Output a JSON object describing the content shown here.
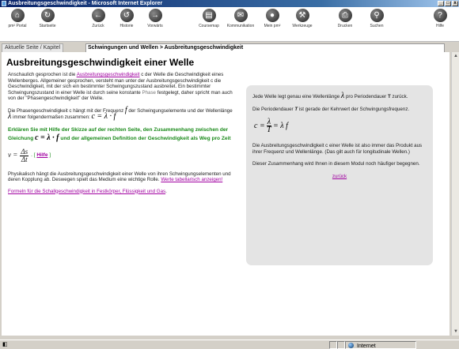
{
  "window": {
    "title": "Ausbreitungsgeschwindigkeit - Microsoft Internet Explorer",
    "btn_min": "_",
    "btn_max": "□",
    "btn_close": "x"
  },
  "toolbar": {
    "items": [
      {
        "label": "pm² Portal",
        "icon": "home-icon",
        "glyph": "⌂"
      },
      {
        "label": "Startseite",
        "icon": "start-icon",
        "glyph": "↻"
      },
      {
        "label": "Zurück",
        "icon": "back-icon",
        "glyph": "←"
      },
      {
        "label": "Historie",
        "icon": "history-icon",
        "glyph": "↺"
      },
      {
        "label": "Vorwärts",
        "icon": "forward-icon",
        "glyph": "→"
      },
      {
        "label": "Coursemap",
        "icon": "coursemap-icon",
        "glyph": "▤"
      },
      {
        "label": "Kommunikation",
        "icon": "communication-icon",
        "glyph": "✉"
      },
      {
        "label": "Mein pm²",
        "icon": "my-pm-icon",
        "glyph": "●"
      },
      {
        "label": "Werkzeuge",
        "icon": "tools-icon",
        "glyph": "⚒"
      },
      {
        "label": "Drucken",
        "icon": "print-icon",
        "glyph": "⎙"
      },
      {
        "label": "Suchen",
        "icon": "search-icon",
        "glyph": "⚲"
      },
      {
        "label": "Hilfe",
        "icon": "help-icon",
        "glyph": "?"
      }
    ]
  },
  "breadcrumb": {
    "label": "Aktuelle Seite / Kapitel",
    "path": "Schwingungen und Wellen > Ausbreitungsgeschwindigkeit"
  },
  "page": {
    "title": "Ausbreitungsgeschwindigkeit einer Welle",
    "p1_a": "Anschaulich gesprochen ist die ",
    "p1_link": "Ausbreitungsgeschwindigkeit",
    "p1_b": " c der Welle die Geschwindigkeit eines Wellenberges. Allgemeiner gesprochen, versteht man unter der Ausbreitungsgeschwindigkeit c die Geschwindigkeit, mit der sich ein bestimmter Schwingungszustand ausbreitet. Ein bestimmter Schwingungszustand in einer Welle ist durch seine konstante ",
    "p1_phase": "Phase",
    "p1_c": " festgelegt, daher spricht man auch von der \"Phasengeschwindigkeit\" der Welle.",
    "p2_a": "Die Phasengeschwindigkeit c hängt mit der Frequenz ",
    "p2_f": "f",
    "p2_b": " der Schwingungselemente und der Wellenlänge ",
    "p2_lambda": "λ",
    "p2_c": " immer folgendermaßen zusammen: ",
    "p2_formula": "c = λ · f",
    "task_a": "Erklären Sie mit Hilfe der Skizze auf der rechten Seite, den Zusammenhang zwischen der Gleichung ",
    "task_formula": "c = λ · f",
    "task_b": " und der allgemeinen Definition der Geschwindigkeit als Weg pro Zeit",
    "v_lhs": "v =",
    "v_num": "Δs",
    "v_den": "Δt",
    "hilfe_open": ". [ ",
    "hilfe_link": "Hilfe",
    "hilfe_close": " ]",
    "p3_a": "Physikalisch hängt die Ausbreitungsgeschwindigkeit einer Welle von ihren Schwingungselementen und deren Kopplung ab. Deswegen spielt das Medium eine wichtige Rolle. ",
    "p3_link": "Werte tabellarisch anzeigen!",
    "formeln_link": "Formeln für die Schallgeschwindigkeit in Festkörper, Flüssigkeit und Gas",
    "formeln_dot": "."
  },
  "panel": {
    "p1_a": "Jede Welle legt genau eine Wellenlänge ",
    "p1_lambda": "λ",
    "p1_b": " pro Periodendauer ",
    "p1_T": "T",
    "p1_c": " zurück.",
    "p2_a": "Die Periodendauer ",
    "p2_T": "T",
    "p2_b": " ist gerade der Kehrwert der Schwingungsfrequenz.",
    "f_lhs": "c =",
    "f_num": "λ",
    "f_den": "T",
    "f_rhs": "= λ f",
    "p3": "Die Ausbreitungsgeschwindigkeit c einer Welle ist also immer das Produkt aus ihrer Frequenz und Wellenlänge. (Das gilt auch für longitudinale Wellen.)",
    "p4": "Dieser Zusammenhang wird Ihnen in diesem Modul noch häufiger begegnen.",
    "back_link": "zurück"
  },
  "status": {
    "left": "",
    "zone": "Internet"
  },
  "colors": {
    "link": "#a000a0",
    "task": "#1a8a1a",
    "panel_bg": "#e4e4e4",
    "title_bar": "#0a246a"
  }
}
